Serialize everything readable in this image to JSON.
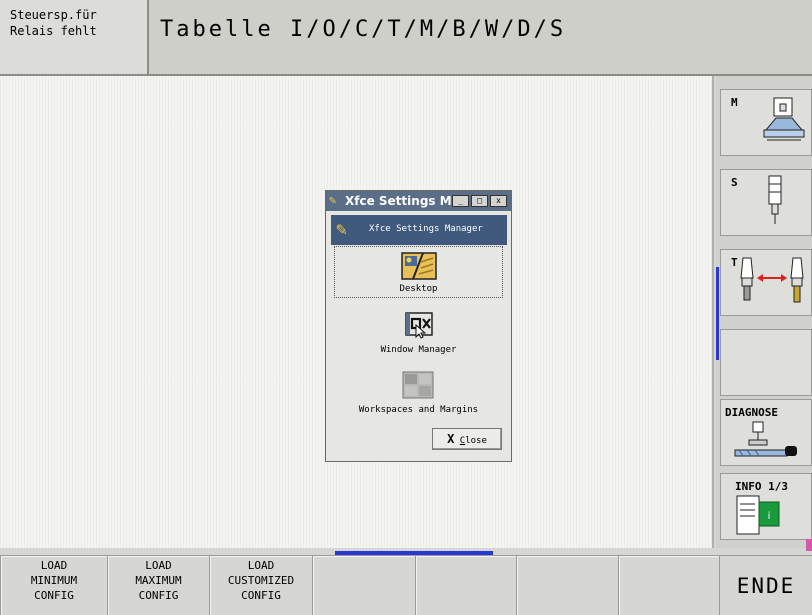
{
  "status": {
    "line1": "Steuersp.für",
    "line2": "Relais fehlt"
  },
  "header": {
    "title": "Tabelle  I/O/C/T/M/B/W/D/S"
  },
  "dialog": {
    "title": "Xfce Settings Manager",
    "window_buttons": [
      "_",
      "□",
      "x"
    ],
    "header_label": "Xfce Settings Manager",
    "items": [
      {
        "label": "Desktop",
        "icon": "desktop-icon",
        "selected": true
      },
      {
        "label": "Window Manager",
        "icon": "window-manager-icon",
        "selected": false
      },
      {
        "label": "Workspaces and Margins",
        "icon": "workspaces-icon",
        "selected": false
      }
    ],
    "close": {
      "mark": "X",
      "key": "C",
      "rest": "lose"
    }
  },
  "right_softkeys": [
    {
      "label": "M",
      "icon": "machine-spindle-icon"
    },
    {
      "label": "S",
      "icon": "spindle-icon"
    },
    {
      "label": "T",
      "icon": "tool-change-icon"
    },
    {
      "label": "",
      "icon": ""
    },
    {
      "label": "DIAGNOSE",
      "icon": "diagnose-icon"
    },
    {
      "label": "INFO 1/3",
      "icon": "info-document-icon"
    }
  ],
  "bottom_softkeys": [
    {
      "lines": [
        "LOAD",
        "MINIMUM",
        "CONFIG"
      ]
    },
    {
      "lines": [
        "LOAD",
        "MAXIMUM",
        "CONFIG"
      ]
    },
    {
      "lines": [
        "LOAD",
        "CUSTOMIZED",
        "CONFIG"
      ]
    },
    {
      "lines": []
    },
    {
      "lines": []
    },
    {
      "lines": []
    },
    {
      "lines": []
    }
  ],
  "ende_label": "ENDE",
  "colors": {
    "accent": "#2a36d8",
    "dialog_title": "#5a6e88",
    "dialog_header": "#3f5a7c",
    "info_green": "#1a9a3c"
  }
}
